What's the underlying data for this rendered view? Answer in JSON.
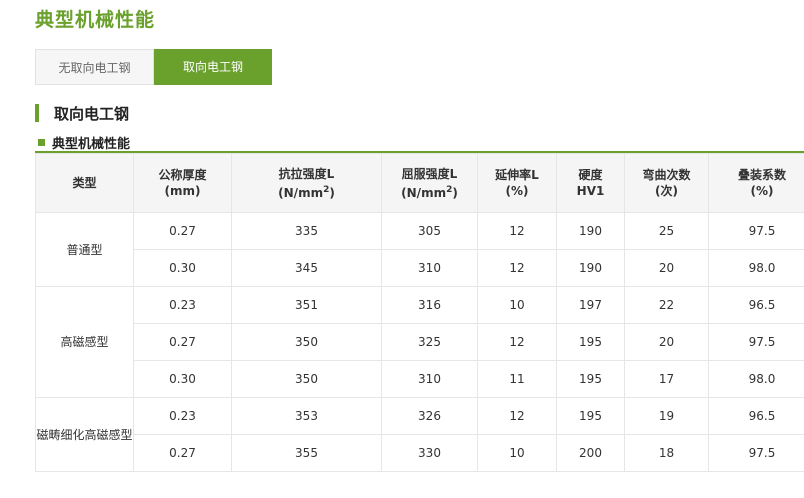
{
  "page": {
    "title": "典型机械性能"
  },
  "tabs": [
    {
      "label": "无取向电工钢",
      "active": false
    },
    {
      "label": "取向电工钢",
      "active": true
    }
  ],
  "section": {
    "title": "取向电工钢",
    "subtitle": "典型机械性能"
  },
  "table": {
    "headers": {
      "type": "类型",
      "thickness": [
        "公称厚度",
        "(mm)"
      ],
      "tensile": [
        "抗拉强度L",
        "(N/mm",
        "2",
        ")"
      ],
      "yield": [
        "屈服强度L",
        "(N/mm",
        "2",
        ")"
      ],
      "elongation": [
        "延伸率L",
        "(%)"
      ],
      "hardness": [
        "硬度",
        "HV1"
      ],
      "bends": [
        "弯曲次数",
        "(次)"
      ],
      "stacking": [
        "叠装系数",
        "(%)"
      ]
    },
    "groups": [
      {
        "name": "普通型",
        "rows": [
          [
            "0.27",
            "335",
            "305",
            "12",
            "190",
            "25",
            "97.5"
          ],
          [
            "0.30",
            "345",
            "310",
            "12",
            "190",
            "20",
            "98.0"
          ]
        ]
      },
      {
        "name": "高磁感型",
        "rows": [
          [
            "0.23",
            "351",
            "316",
            "10",
            "197",
            "22",
            "96.5"
          ],
          [
            "0.27",
            "350",
            "325",
            "12",
            "195",
            "20",
            "97.5"
          ],
          [
            "0.30",
            "350",
            "310",
            "11",
            "195",
            "17",
            "98.0"
          ]
        ]
      },
      {
        "name": "磁畴细化高磁感型",
        "rows": [
          [
            "0.23",
            "353",
            "326",
            "12",
            "195",
            "19",
            "96.5"
          ],
          [
            "0.27",
            "355",
            "330",
            "10",
            "200",
            "18",
            "97.5"
          ]
        ]
      }
    ]
  },
  "colors": {
    "accent": "#6aa02c"
  }
}
